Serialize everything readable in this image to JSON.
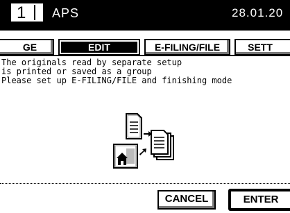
{
  "header": {
    "copy_count": "1",
    "mode": "APS",
    "date": "28.01.20"
  },
  "tabs": [
    {
      "label": "GE",
      "active": false
    },
    {
      "label": "EDIT",
      "active": true
    },
    {
      "label": "E-FILING/FILE",
      "active": false
    },
    {
      "label": "SETT",
      "active": false
    }
  ],
  "message": {
    "line1": "The originals read by separate setup",
    "line2": "is printed or saved as a group",
    "line3": "Please set up E-FILING/FILE and finishing mode"
  },
  "illustration": {
    "icons": [
      "document-icon",
      "photo-document-icon",
      "stacked-documents-icon",
      "arrow-right-icon",
      "arrow-down-right-icon"
    ]
  },
  "buttons": {
    "cancel": "CANCEL",
    "enter": "ENTER"
  }
}
